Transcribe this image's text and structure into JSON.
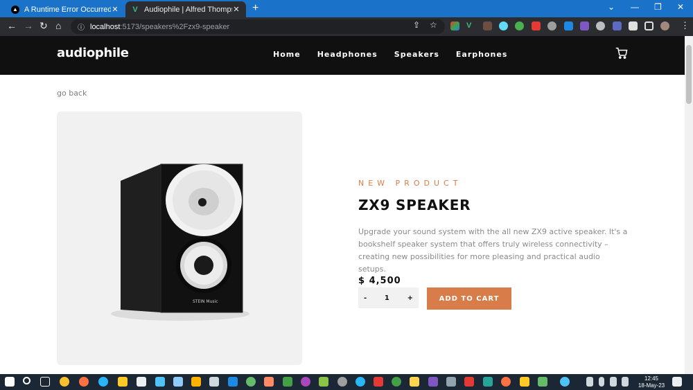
{
  "browser": {
    "tabs": [
      {
        "title": "A Runtime Error Occurred – Verce",
        "close": "✕",
        "active": false
      },
      {
        "title": "Audiophile | Alfred Thompson O",
        "close": "✕",
        "active": true
      }
    ],
    "new_tab": "+",
    "window_controls": [
      "⌄",
      "—",
      "❐",
      "✕"
    ],
    "url_host": "localhost",
    "url_path": ":5173/speakers%2Fzx9-speaker",
    "menu": "⋮"
  },
  "site": {
    "logo": "audiophile",
    "nav": [
      "Home",
      "Headphones",
      "Speakers",
      "Earphones"
    ],
    "go_back": "go back",
    "product": {
      "overline": "NEW PRODUCT",
      "name": "ZX9 SPEAKER",
      "description": "Upgrade your sound system with the all new ZX9 active speaker. It's a bookshelf speaker system that offers truly wireless connectivity – creating new possibilities for more pleasing and practical audio setups.",
      "price": "$ 4,500",
      "quantity": "1",
      "decrement": "-",
      "increment": "+",
      "add_to_cart": "ADD TO CART",
      "brand_mark": "STEIN Music"
    }
  },
  "taskbar": {
    "time": "12:45",
    "date": "18-May-23"
  },
  "colors": {
    "accent": "#d87d4a",
    "header_bg": "#101010",
    "card_bg": "#f1f1f1",
    "tab_strip": "#1a73c9"
  }
}
